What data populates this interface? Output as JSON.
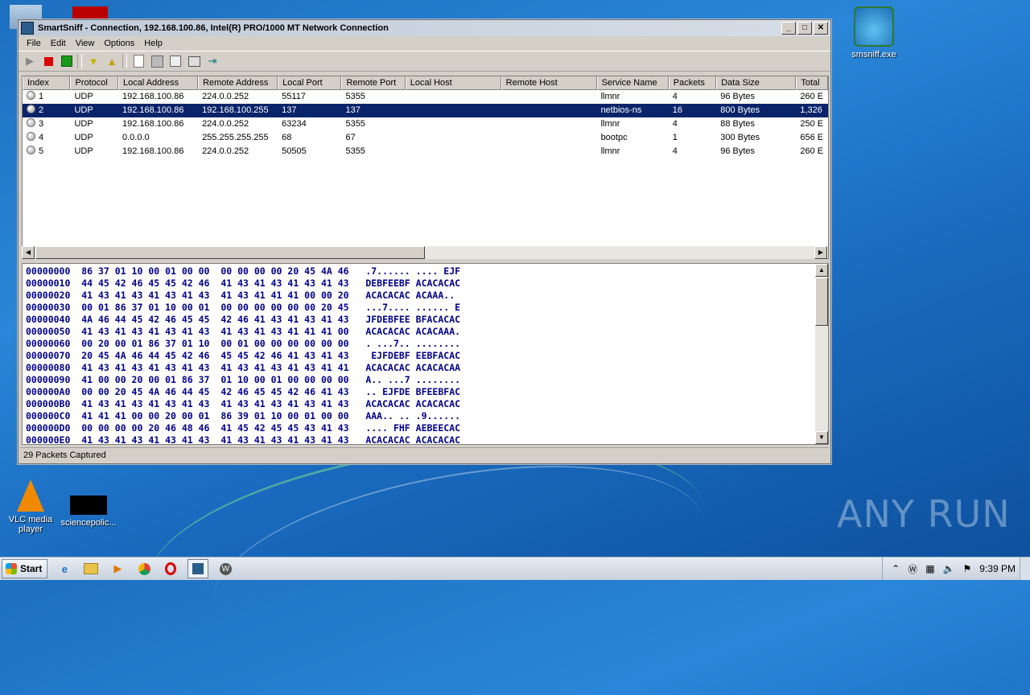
{
  "window": {
    "title": "SmartSniff  -  Connection, 192.168.100.86, Intel(R) PRO/1000 MT Network Connection",
    "minimize": "_",
    "maximize": "□",
    "close": "✕"
  },
  "menu": [
    "File",
    "Edit",
    "View",
    "Options",
    "Help"
  ],
  "toolbar_icons": [
    "play-icon",
    "stop-icon",
    "capture-icon",
    "filter-icon",
    "filter-alt-icon",
    "new-icon",
    "save-icon",
    "copy-icon",
    "properties-icon",
    "exit-icon"
  ],
  "columns": [
    "Index",
    "Protocol",
    "Local Address",
    "Remote Address",
    "Local Port",
    "Remote Port",
    "Local Host",
    "Remote Host",
    "Service Name",
    "Packets",
    "Data Size",
    "Total"
  ],
  "rows": [
    {
      "index": "1",
      "protocol": "UDP",
      "local_address": "192.168.100.86",
      "remote_address": "224.0.0.252",
      "local_port": "55117",
      "remote_port": "5355",
      "local_host": "",
      "remote_host": "",
      "service": "llmnr",
      "packets": "4",
      "data_size": "96 Bytes",
      "total": "260 E",
      "selected": false
    },
    {
      "index": "2",
      "protocol": "UDP",
      "local_address": "192.168.100.86",
      "remote_address": "192.168.100.255",
      "local_port": "137",
      "remote_port": "137",
      "local_host": "",
      "remote_host": "",
      "service": "netbios-ns",
      "packets": "16",
      "data_size": "800 Bytes",
      "total": "1,326",
      "selected": true
    },
    {
      "index": "3",
      "protocol": "UDP",
      "local_address": "192.168.100.86",
      "remote_address": "224.0.0.252",
      "local_port": "63234",
      "remote_port": "5355",
      "local_host": "",
      "remote_host": "",
      "service": "llmnr",
      "packets": "4",
      "data_size": "88 Bytes",
      "total": "250 E",
      "selected": false
    },
    {
      "index": "4",
      "protocol": "UDP",
      "local_address": "0.0.0.0",
      "remote_address": "255.255.255.255",
      "local_port": "68",
      "remote_port": "67",
      "local_host": "",
      "remote_host": "",
      "service": "bootpc",
      "packets": "1",
      "data_size": "300 Bytes",
      "total": "656 E",
      "selected": false
    },
    {
      "index": "5",
      "protocol": "UDP",
      "local_address": "192.168.100.86",
      "remote_address": "224.0.0.252",
      "local_port": "50505",
      "remote_port": "5355",
      "local_host": "",
      "remote_host": "",
      "service": "llmnr",
      "packets": "4",
      "data_size": "96 Bytes",
      "total": "260 E",
      "selected": false
    }
  ],
  "hex_lines": [
    "00000000  86 37 01 10 00 01 00 00  00 00 00 00 20 45 4A 46   .7...... .... EJF",
    "00000010  44 45 42 46 45 45 42 46  41 43 41 43 41 43 41 43   DEBFEEBF ACACACAC",
    "00000020  41 43 41 43 41 43 41 43  41 43 41 41 41 00 00 20   ACACACAC ACAAA.. ",
    "00000030  00 01 86 37 01 10 00 01  00 00 00 00 00 00 20 45   ...7.... ...... E",
    "00000040  4A 46 44 45 42 46 45 45  42 46 41 43 41 43 41 43   JFDEBFEE BFACACAC",
    "00000050  41 43 41 43 41 43 41 43  41 43 41 43 41 41 41 00   ACACACAC ACACAAA.",
    "00000060  00 20 00 01 86 37 01 10  00 01 00 00 00 00 00 00   . ...7.. ........",
    "00000070  20 45 4A 46 44 45 42 46  45 45 42 46 41 43 41 43    EJFDEBF EEBFACAC",
    "00000080  41 43 41 43 41 43 41 43  41 43 41 43 41 43 41 41   ACACACAC ACACACAA",
    "00000090  41 00 00 20 00 01 86 37  01 10 00 01 00 00 00 00   A.. ...7 ........",
    "000000A0  00 00 20 45 4A 46 44 45  42 46 45 45 42 46 41 43   .. EJFDE BFEEBFAC",
    "000000B0  41 43 41 43 41 43 41 43  41 43 41 43 41 43 41 43   ACACACAC ACACACAC",
    "000000C0  41 41 41 00 00 20 00 01  86 39 01 10 00 01 00 00   AAA.. .. .9......",
    "000000D0  00 00 00 00 20 46 48 46  41 45 42 45 45 43 41 43   .... FHF AEBEECAC",
    "000000E0  41 43 41 43 41 43 41 43  41 43 41 43 41 43 41 43   ACACACAC ACACACAC"
  ],
  "status": "29 Packets Captured",
  "desktop": {
    "icon_smsniff": "smsniff.exe",
    "icon_vlc": "VLC media player",
    "icon_science": "sciencepolic...",
    "watermark": "ANY RUN"
  },
  "taskbar": {
    "start": "Start",
    "clock": "9:39 PM"
  }
}
